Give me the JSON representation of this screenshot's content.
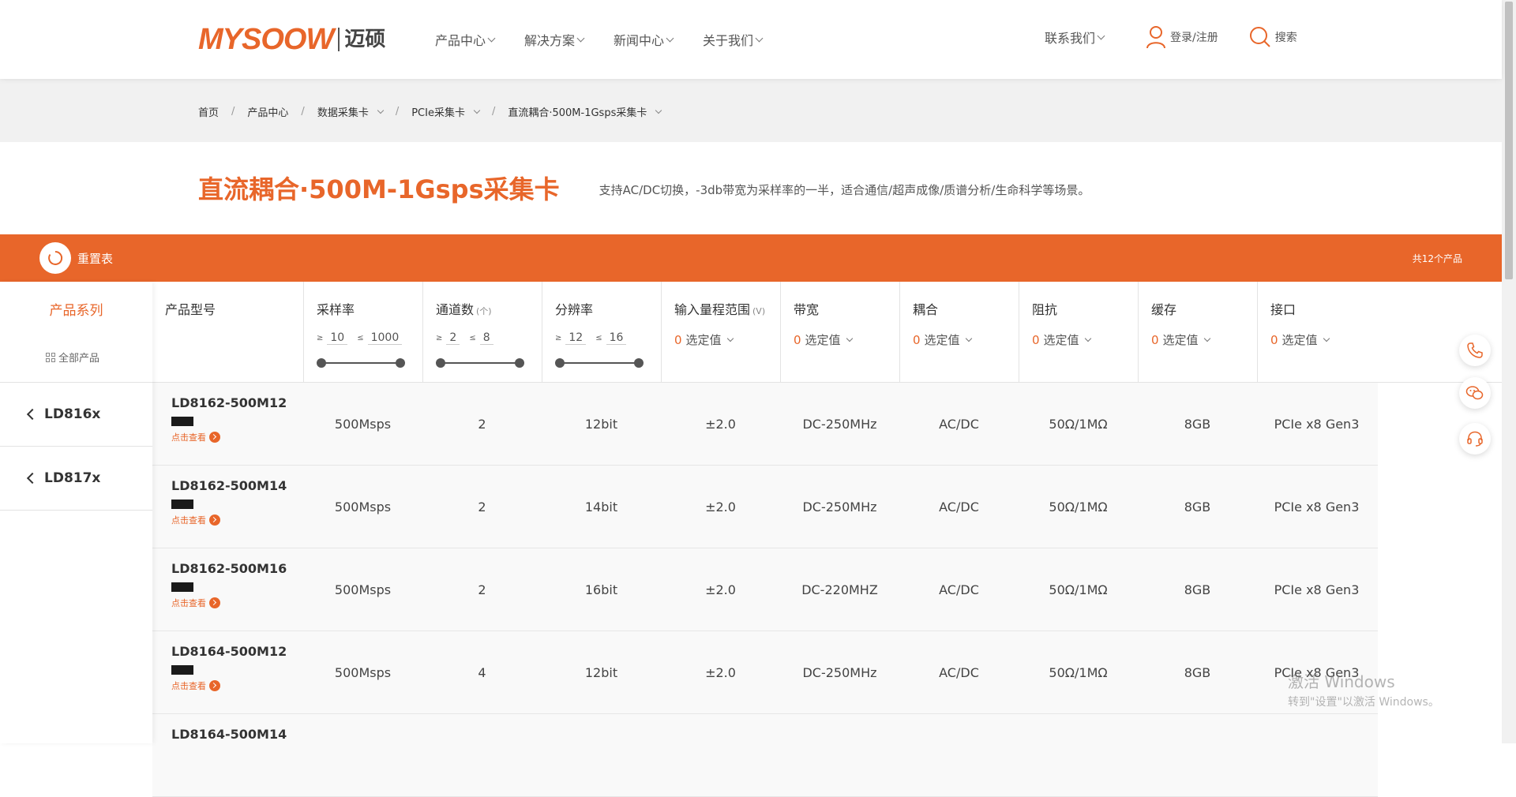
{
  "header": {
    "logo_en": "MYSOOW",
    "logo_cn": "迈硕",
    "nav": [
      "产品中心",
      "解决方案",
      "新闻中心",
      "关于我们"
    ],
    "contact": "联系我们",
    "login": "登录/注册",
    "search": "搜索"
  },
  "breadcrumb": [
    "首页",
    "产品中心",
    "数据采集卡",
    "PCIe采集卡",
    "直流耦合·500M-1Gsps采集卡"
  ],
  "page": {
    "title": "直流耦合·500M-1Gsps采集卡",
    "desc": "支持AC/DC切换，-3db带宽为采样率的一半，适合通信/超声成像/质谱分析/生命科学等场景。"
  },
  "toolbar": {
    "reset": "重置表",
    "count": "共12个产品"
  },
  "sidebar": {
    "title": "产品系列",
    "all": "全部产品",
    "items": [
      "LD816x",
      "LD817x"
    ]
  },
  "filters": {
    "model": "产品型号",
    "sample_rate": {
      "label": "采样率",
      "ge": "≥",
      "le": "≤",
      "min": "10",
      "max": "1000"
    },
    "channels": {
      "label": "通道数",
      "unit": "(个)",
      "ge": "≥",
      "le": "≤",
      "min": "2",
      "max": "8"
    },
    "resolution": {
      "label": "分辨率",
      "ge": "≥",
      "le": "≤",
      "min": "12",
      "max": "16"
    },
    "input_range": {
      "label": "输入量程范围",
      "unit": "(V)",
      "count": "0",
      "text": "选定值"
    },
    "bandwidth": {
      "label": "带宽",
      "count": "0",
      "text": "选定值"
    },
    "coupling": {
      "label": "耦合",
      "count": "0",
      "text": "选定值"
    },
    "impedance": {
      "label": "阻抗",
      "count": "0",
      "text": "选定值"
    },
    "cache": {
      "label": "缓存",
      "count": "0",
      "text": "选定值"
    },
    "interface": {
      "label": "接口",
      "count": "0",
      "text": "选定值"
    }
  },
  "view_label": "点击查看",
  "rows": [
    {
      "model": "LD8162-500M12",
      "rate": "500Msps",
      "ch": "2",
      "res": "12bit",
      "range": "±2.0",
      "bw": "DC-250MHz",
      "cpl": "AC/DC",
      "imp": "50Ω/1MΩ",
      "cache": "8GB",
      "if": "PCIe x8 Gen3"
    },
    {
      "model": "LD8162-500M14",
      "rate": "500Msps",
      "ch": "2",
      "res": "14bit",
      "range": "±2.0",
      "bw": "DC-250MHz",
      "cpl": "AC/DC",
      "imp": "50Ω/1MΩ",
      "cache": "8GB",
      "if": "PCIe x8 Gen3"
    },
    {
      "model": "LD8162-500M16",
      "rate": "500Msps",
      "ch": "2",
      "res": "16bit",
      "range": "±2.0",
      "bw": "DC-220MHZ",
      "cpl": "AC/DC",
      "imp": "50Ω/1MΩ",
      "cache": "8GB",
      "if": "PCIe x8 Gen3"
    },
    {
      "model": "LD8164-500M12",
      "rate": "500Msps",
      "ch": "4",
      "res": "12bit",
      "range": "±2.0",
      "bw": "DC-250MHz",
      "cpl": "AC/DC",
      "imp": "50Ω/1MΩ",
      "cache": "8GB",
      "if": "PCIe x8 Gen3"
    },
    {
      "model": "LD8164-500M14",
      "rate": "",
      "ch": "",
      "res": "",
      "range": "",
      "bw": "",
      "cpl": "",
      "imp": "",
      "cache": "",
      "if": ""
    }
  ],
  "watermark": {
    "line1": "激活 Windows",
    "line2": "转到\"设置\"以激活 Windows。"
  },
  "colors": {
    "accent": "#e8662a"
  }
}
